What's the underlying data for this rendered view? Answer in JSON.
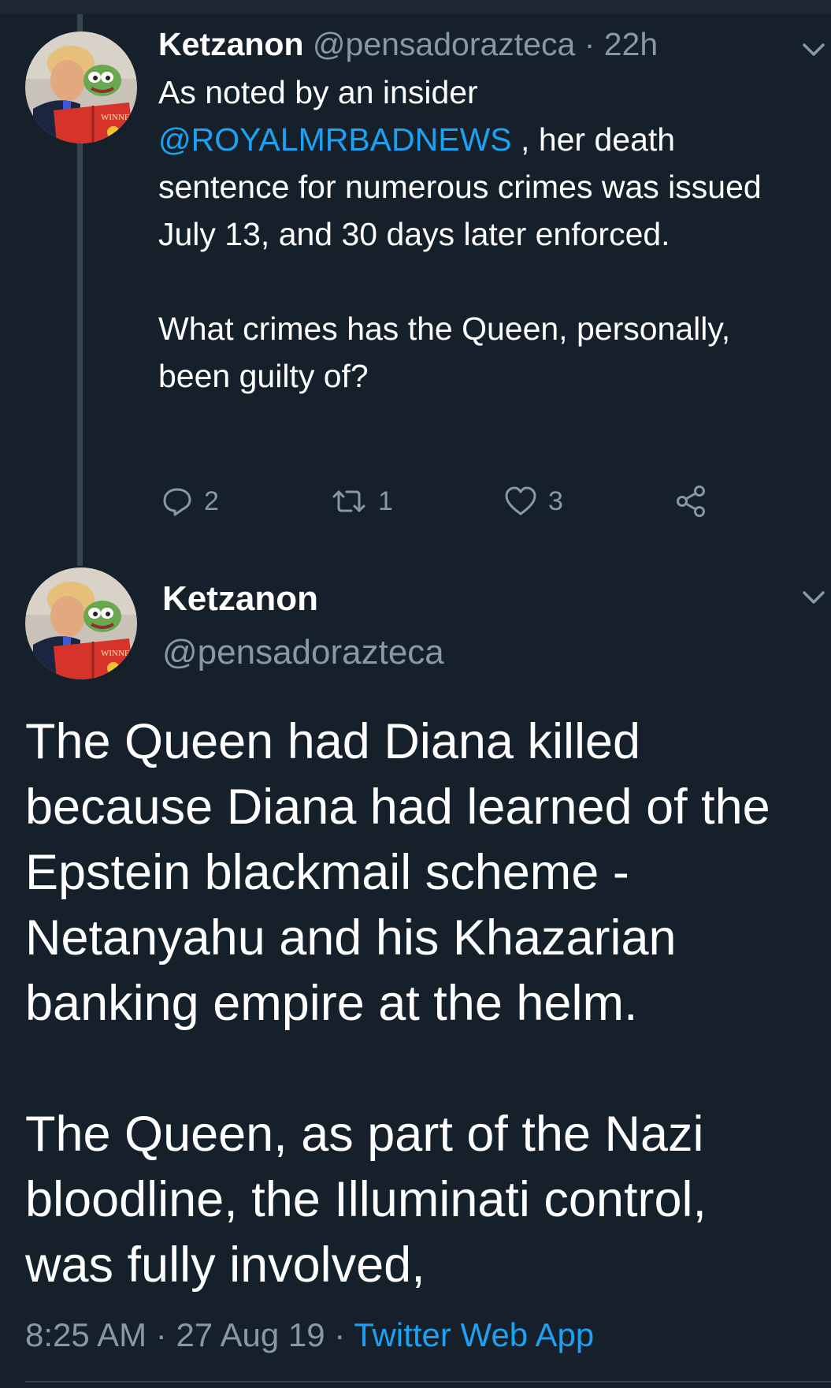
{
  "colors": {
    "background": "#15202b",
    "text": "#ffffff",
    "secondary": "#8899a6",
    "accent": "#1da1f2",
    "line": "#38444d"
  },
  "reply": {
    "display_name": "Ketzanon",
    "handle": "@pensadorazteca",
    "separator": " · ",
    "time": "22h",
    "text_before_mention": "As noted by an insider",
    "mention": "@ROYALMRBADNEWS",
    "text_after_mention": " , her death sentence for numerous crimes was issued July 13, and 30 days later enforced.",
    "paragraph_2": "What crimes has the Queen, personally, been guilty of?",
    "reply_count": "2",
    "retweet_count": "1",
    "like_count": "3",
    "avatar_text": "WINNERS"
  },
  "main": {
    "display_name": "Ketzanon",
    "handle": "@pensadorazteca",
    "paragraph_1": "The Queen had Diana killed because Diana had learned of the Epstein blackmail scheme - Netanyahu and his Khazarian banking empire at the helm.",
    "paragraph_2": "The Queen, as part of the Nazi bloodline, the Illuminati control, was fully involved,",
    "time": "8:25 AM",
    "date": "27 Aug 19",
    "separator": " · ",
    "source": "Twitter Web App",
    "avatar_text": "WINNERS"
  }
}
